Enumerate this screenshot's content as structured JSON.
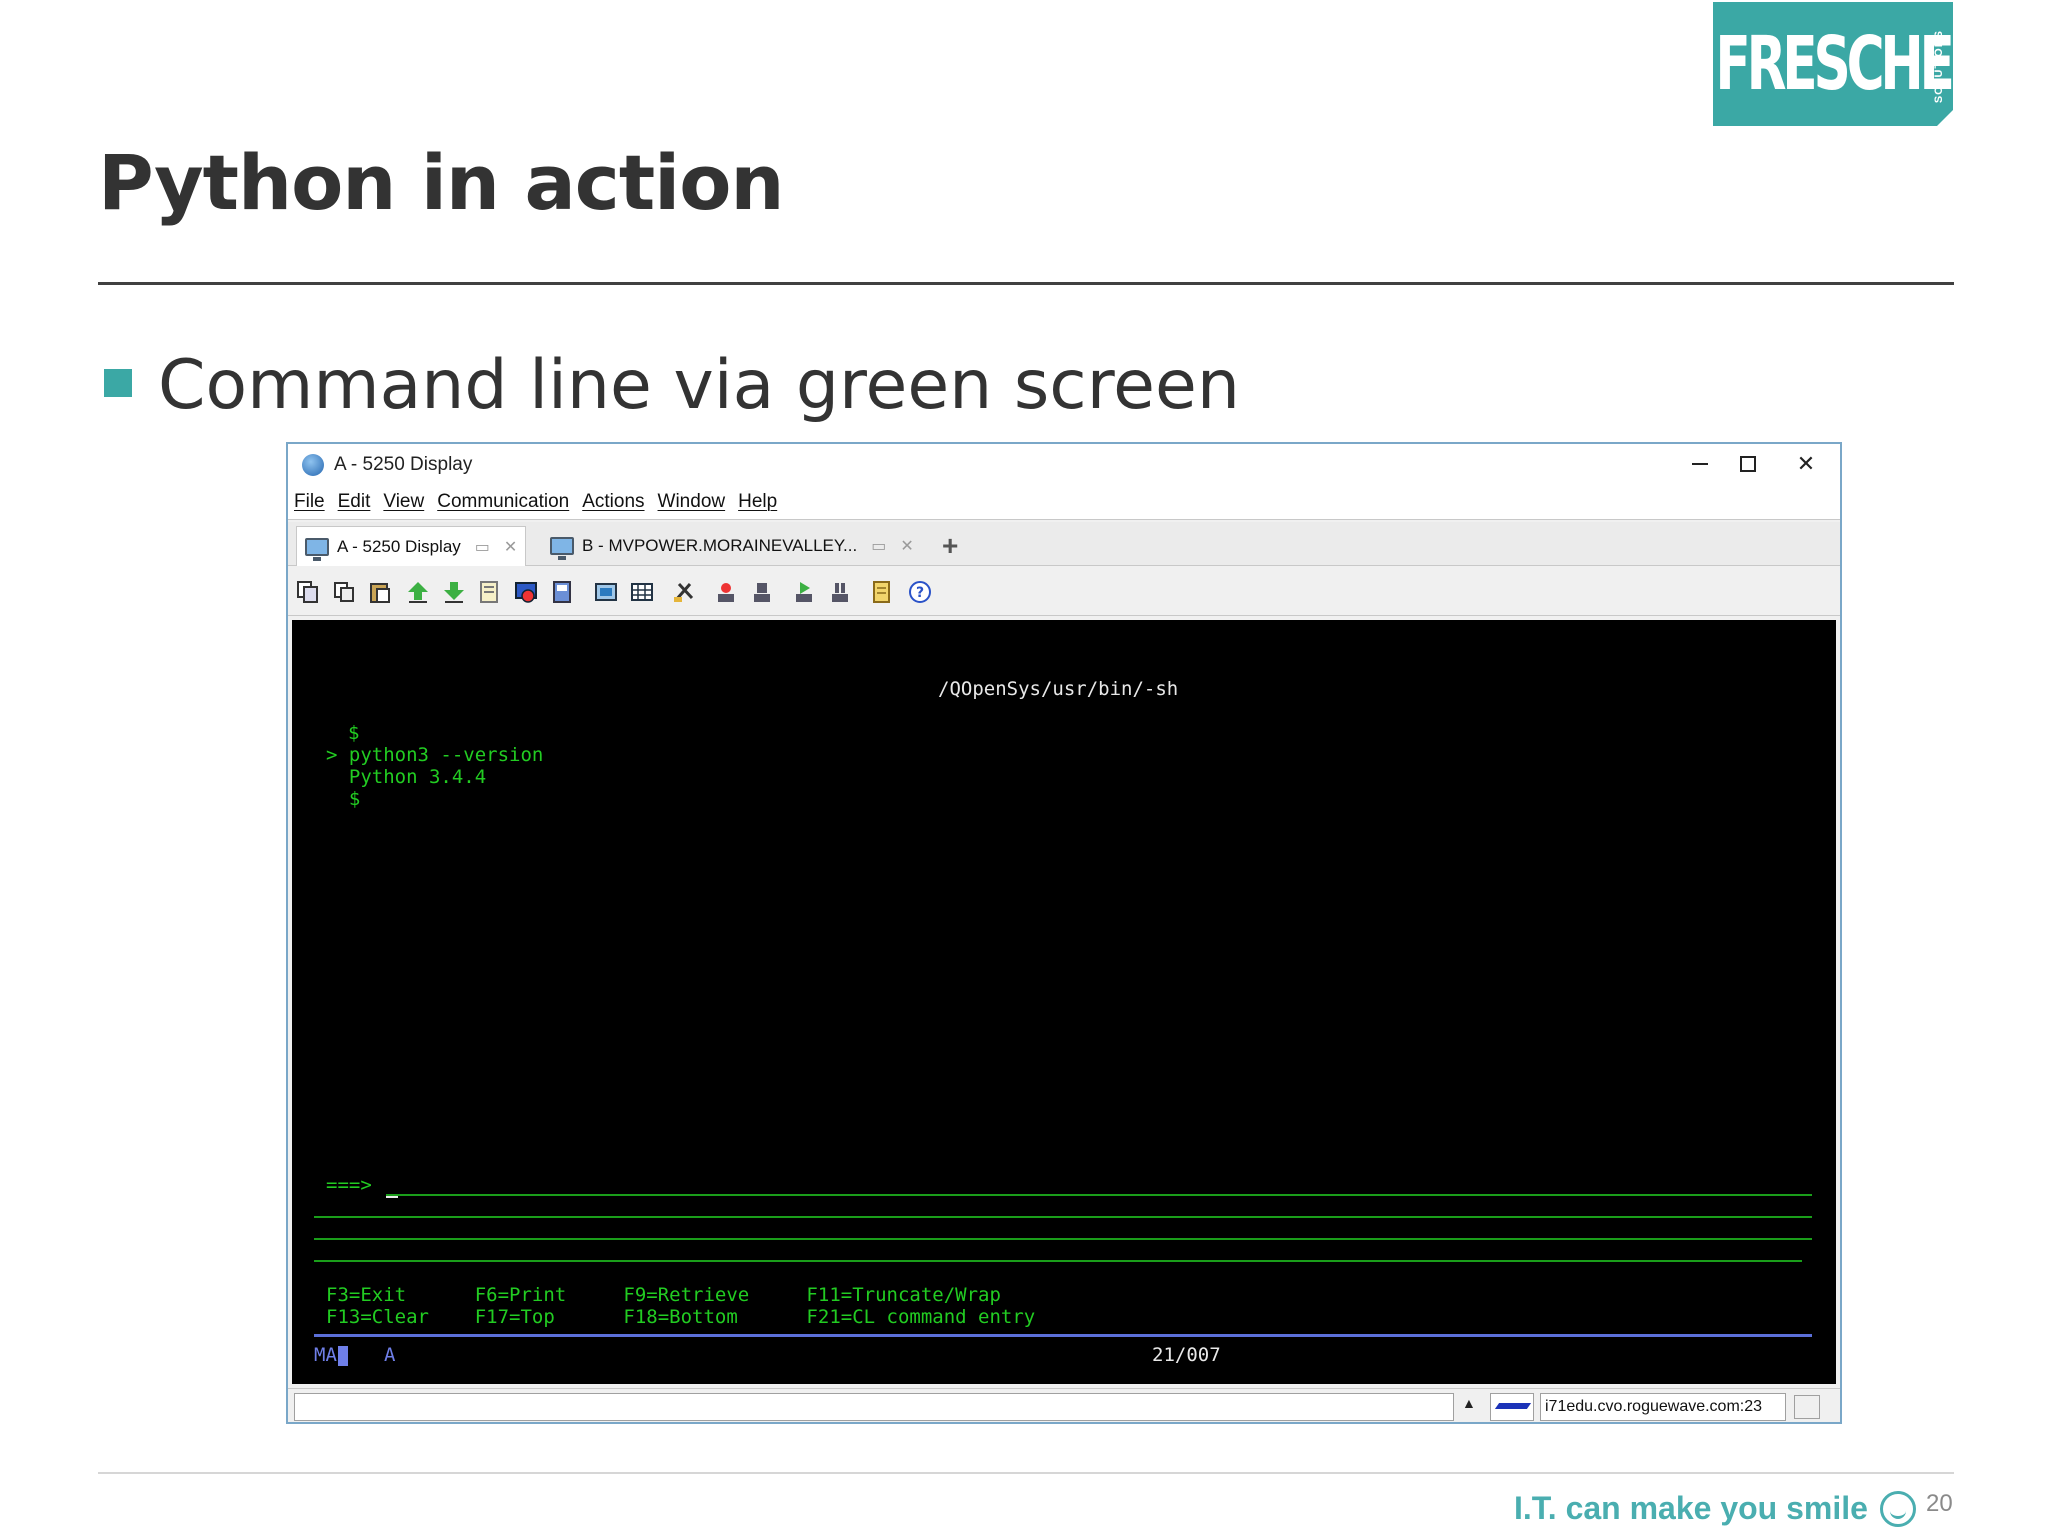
{
  "slide": {
    "title": "Python in action",
    "bullet": "Command line via green screen",
    "logo_text": "FRESCHE",
    "logo_sub": "SOLUTIONS",
    "tagline": "I.T. can make you smile",
    "page_number": "20",
    "accent_color": "#3ba8a5"
  },
  "window": {
    "title": "A - 5250 Display",
    "menu": [
      "File",
      "Edit",
      "View",
      "Communication",
      "Actions",
      "Window",
      "Help"
    ],
    "tabs": [
      {
        "label": "A - 5250 Display"
      },
      {
        "label": "B - MVPOWER.MORAINEVALLEY..."
      }
    ],
    "toolbar_icons": [
      "copy-icon",
      "copy-append-icon",
      "paste-icon",
      "send-file-icon",
      "receive-file-icon",
      "print-screen-icon",
      "macro-record-icon",
      "macro-play-icon",
      "keypad-icon",
      "display-grid-icon",
      "tools-icon",
      "record-icon",
      "stop-icon",
      "play-icon",
      "pause-icon",
      "notes-icon",
      "help-icon"
    ]
  },
  "terminal": {
    "path": "/QOpenSys/usr/bin/-sh",
    "lines": [
      "$",
      "> python3 --version",
      "  Python 3.4.4",
      "  $"
    ],
    "prompt": "===>",
    "fkeys_row1": "F3=Exit      F6=Print     F9=Retrieve     F11=Truncate/Wrap",
    "fkeys_row2": "F13=Clear    F17=Top      F18=Bottom      F21=CL command entry",
    "oia_mode": "MA",
    "oia_session": "A",
    "cursor_pos": "21/007"
  },
  "status": {
    "host": "i71edu.cvo.roguewave.com:23"
  }
}
